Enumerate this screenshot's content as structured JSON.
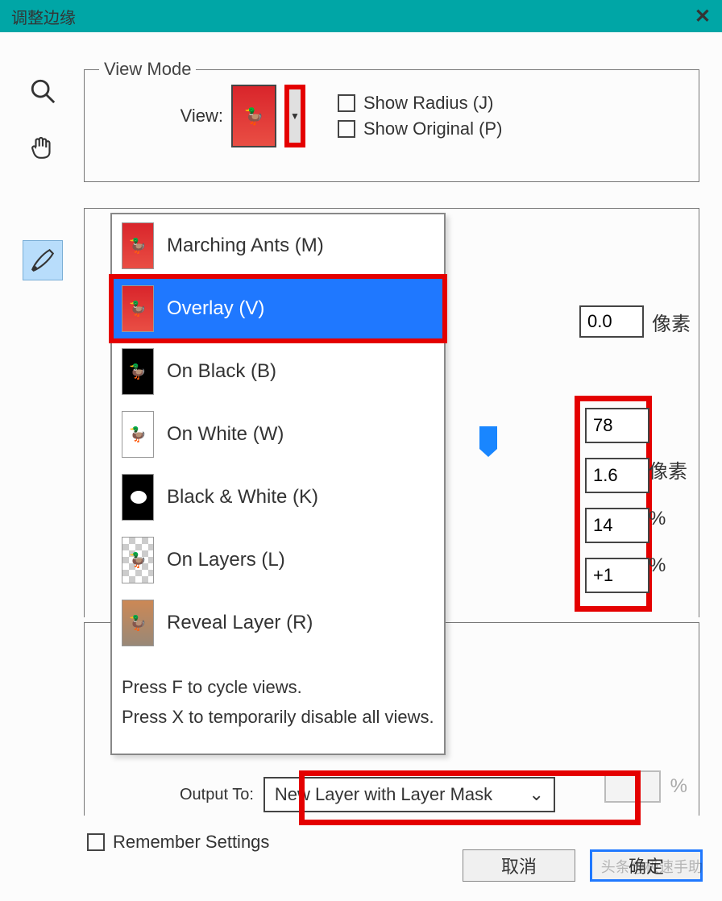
{
  "title": "调整边缘",
  "close_glyph": "✕",
  "view_mode": {
    "legend": "View Mode",
    "view_label": "View:"
  },
  "checkboxes": {
    "show_radius": "Show Radius (J)",
    "show_original": "Show Original (P)"
  },
  "dropdown": {
    "items": [
      {
        "label": "Marching Ants (M)"
      },
      {
        "label": "Overlay (V)"
      },
      {
        "label": "On Black (B)"
      },
      {
        "label": "On White (W)"
      },
      {
        "label": "Black & White (K)"
      },
      {
        "label": "On Layers (L)"
      },
      {
        "label": "Reveal Layer (R)"
      }
    ],
    "footer1": "Press F to cycle views.",
    "footer2": "Press X to temporarily disable all views."
  },
  "values": {
    "radius": "0.0",
    "smooth": "78",
    "feather": "1.6",
    "contrast": "14",
    "shift": "+1"
  },
  "units": {
    "px": "像素",
    "px2": "像素",
    "pct": "%",
    "pct2": "%",
    "pct_dim": "%"
  },
  "output": {
    "label": "Output To:",
    "selected": "New Layer with Layer Mask"
  },
  "remember": "Remember Settings",
  "buttons": {
    "cancel": "取消",
    "ok": "确定"
  },
  "watermark": "头条@极速手助"
}
